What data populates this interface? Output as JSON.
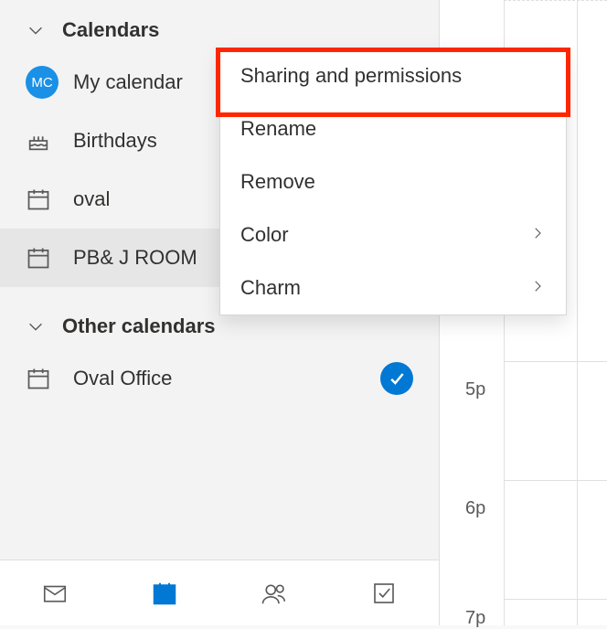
{
  "groups": [
    {
      "label": "Calendars",
      "items": [
        {
          "kind": "avatar",
          "avatar": "MC",
          "label": "My calendar",
          "checked": false
        },
        {
          "kind": "birthday",
          "label": "Birthdays",
          "checked": false
        },
        {
          "kind": "calendar",
          "label": "oval",
          "checked": false
        },
        {
          "kind": "calendar",
          "label": "PB& J ROOM",
          "checked": true,
          "selected": true,
          "checkColor": "purple"
        }
      ]
    },
    {
      "label": "Other calendars",
      "items": [
        {
          "kind": "calendar",
          "label": "Oval Office",
          "checked": true,
          "checkColor": "blue"
        }
      ]
    }
  ],
  "contextMenu": {
    "items": [
      {
        "label": "Sharing and permissions",
        "submenu": false
      },
      {
        "label": "Rename",
        "submenu": false
      },
      {
        "label": "Remove",
        "submenu": false
      },
      {
        "label": "Color",
        "submenu": true
      },
      {
        "label": "Charm",
        "submenu": true
      }
    ]
  },
  "timeline": {
    "labels": [
      "5p",
      "6p",
      "7p"
    ]
  },
  "footer": {
    "active": "calendar"
  }
}
